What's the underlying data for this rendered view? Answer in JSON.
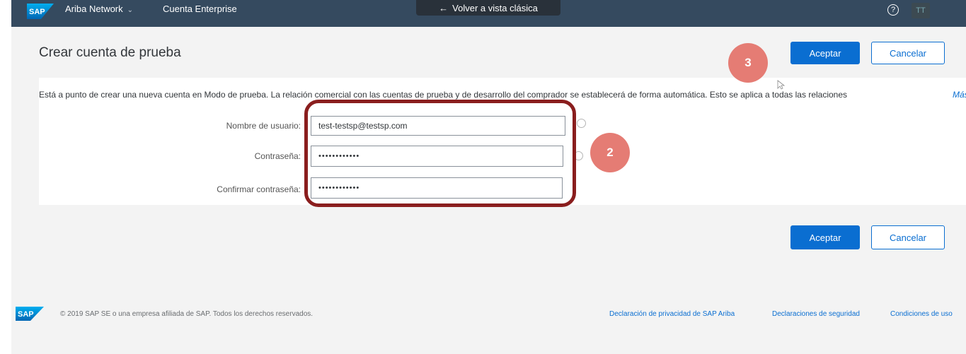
{
  "header": {
    "brand": "Ariba Network",
    "brand_chevron": "⌄",
    "account": "Cuenta Enterprise",
    "classic_view": "Volver a vista clásica",
    "classic_arrow": "←",
    "help_icon": "?",
    "avatar": "TT",
    "logo_text": "SAP"
  },
  "page": {
    "title": "Crear cuenta de prueba",
    "accept_label": "Aceptar",
    "cancel_label": "Cancelar"
  },
  "info": {
    "text": "Está a punto de crear una nueva cuenta en Modo de prueba. La relación comercial con las cuentas de prueba y de desarrollo del comprador se establecerá de forma automática. Esto se aplica a todas las relaciones",
    "more_link": "Más"
  },
  "form": {
    "username_label": "Nombre de usuario:",
    "username_value": "test-testsp@testsp.com",
    "password_label": "Contraseña:",
    "password_value": "••••••••••••",
    "confirm_label": "Confirmar contraseña:",
    "confirm_value": "••••••••••••"
  },
  "annotations": {
    "step_2": "2",
    "step_3": "3",
    "highlight_color": "#8a1e1e",
    "badge_color": "#e57c74"
  },
  "footer": {
    "logo_text": "SAP",
    "copyright": "© 2019 SAP SE o una empresa afiliada de SAP. Todos los derechos reservados.",
    "links": [
      "Declaración de privacidad de SAP Ariba",
      "Declaraciones de seguridad",
      "Condiciones de uso"
    ]
  },
  "colors": {
    "topbar": "#354a5f",
    "primary": "#0a6ed1"
  }
}
